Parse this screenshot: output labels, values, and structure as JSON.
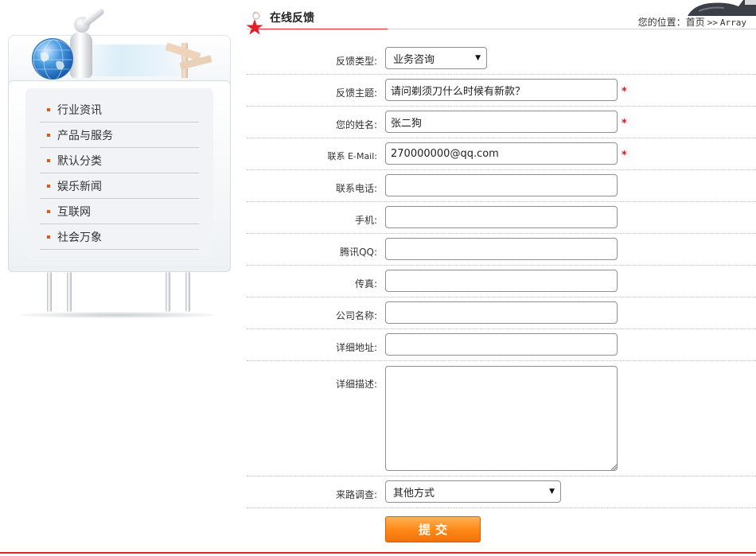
{
  "sidebar": {
    "categories": [
      {
        "label": "行业资讯"
      },
      {
        "label": "产品与服务"
      },
      {
        "label": "默认分类"
      },
      {
        "label": "娱乐新闻"
      },
      {
        "label": "互联网"
      },
      {
        "label": "社会万象"
      }
    ]
  },
  "header": {
    "title": "在线反馈",
    "breadcrumb": {
      "prefix": "您的位置：",
      "home": "首页",
      "separator": ">>",
      "current": "Array"
    }
  },
  "form": {
    "feedback_type": {
      "label": "反馈类型:",
      "selected": "业务咨询"
    },
    "subject": {
      "label": "反馈主题:",
      "value": "请问剃须刀什么时候有新款？",
      "required_mark": "*"
    },
    "name": {
      "label": "您的姓名:",
      "value": "张二狗",
      "required_mark": "*"
    },
    "email": {
      "label": "联系 E-Mail:",
      "value": "270000000@qq.com",
      "required_mark": "*"
    },
    "phone": {
      "label": "联系电话:",
      "value": ""
    },
    "mobile": {
      "label": "手机:",
      "value": ""
    },
    "qq": {
      "label": "腾讯QQ:",
      "value": ""
    },
    "fax": {
      "label": "传真:",
      "value": ""
    },
    "company": {
      "label": "公司名称:",
      "value": ""
    },
    "address": {
      "label": "详细地址:",
      "value": ""
    },
    "description": {
      "label": "详细描述:",
      "value": ""
    },
    "source": {
      "label": "来路调查:",
      "selected": "其他方式"
    },
    "submit_label": "提交"
  },
  "colors": {
    "accent_red": "#e0212b",
    "bullet_orange": "#e6550d",
    "submit_orange": "#ff8a18"
  },
  "icons": {
    "header": "star-icon",
    "sidebar": "globe-icon",
    "select_arrow": "triangle-down-icon"
  }
}
